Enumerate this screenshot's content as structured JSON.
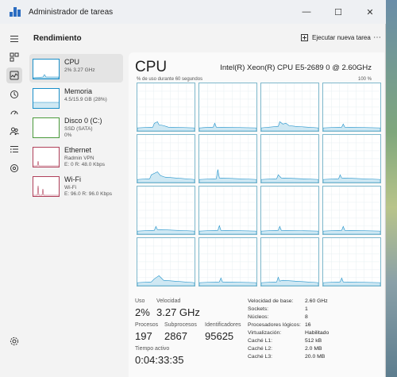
{
  "window": {
    "title": "Administrador de tareas",
    "minimize": "—",
    "maximize": "☐",
    "close": "✕"
  },
  "rail": [
    "menu-icon",
    "processes-icon",
    "performance-icon",
    "history-icon",
    "startup-icon",
    "users-icon",
    "details-icon",
    "services-icon",
    "settings-icon"
  ],
  "header": {
    "title": "Rendimiento",
    "run_task": "Ejecutar nueva tarea",
    "more": "⋯"
  },
  "sidebar": {
    "items": [
      {
        "name": "CPU",
        "sub1": "2% 3.27 GHz",
        "sub2": "",
        "sub3": "",
        "color": "#1a8fc9"
      },
      {
        "name": "Memoria",
        "sub1": "4.5/15.9 GB (28%)",
        "sub2": "",
        "sub3": "",
        "color": "#1a8fc9"
      },
      {
        "name": "Disco 0 (C:)",
        "sub1": "SSD (SATA)",
        "sub2": "0%",
        "sub3": "",
        "color": "#4a9a3a"
      },
      {
        "name": "Ethernet",
        "sub1": "Radmin VPN",
        "sub2": "E: 0 R: 48.0 Kbps",
        "sub3": "",
        "color": "#b0405a"
      },
      {
        "name": "Wi-Fi",
        "sub1": "Wi-Fi",
        "sub2": "E: 96.0 R: 96.0 Kbps",
        "sub3": "",
        "color": "#b0405a"
      }
    ]
  },
  "main": {
    "title": "CPU",
    "model": "Intel(R) Xeon(R) CPU E5-2689 0 @ 2.60GHz",
    "graph_label": "% de uso durante 60 segundos",
    "graph_max": "100 %",
    "accent": "#1a8fc9",
    "stats": {
      "uso_label": "Uso",
      "uso": "2%",
      "velocidad_label": "Velocidad",
      "velocidad": "3.27 GHz",
      "procesos_label": "Procesos",
      "procesos": "197",
      "subprocesos_label": "Subprocesos",
      "subprocesos": "2867",
      "identificadores_label": "Identificadores",
      "identificadores": "95625",
      "tiempo_label": "Tiempo activo",
      "tiempo": "0:04:33:35"
    },
    "specs": [
      {
        "k": "Velocidad de base:",
        "v": "2.60 GHz"
      },
      {
        "k": "Sockets:",
        "v": "1"
      },
      {
        "k": "Núcleos:",
        "v": "8"
      },
      {
        "k": "Procesadores lógicos:",
        "v": "16"
      },
      {
        "k": "Virtualización:",
        "v": "Habilitado"
      },
      {
        "k": "Caché L1:",
        "v": "512 kB"
      },
      {
        "k": "Caché L2:",
        "v": "2.0 MB"
      },
      {
        "k": "Caché L3:",
        "v": "20.0 MB"
      }
    ]
  }
}
